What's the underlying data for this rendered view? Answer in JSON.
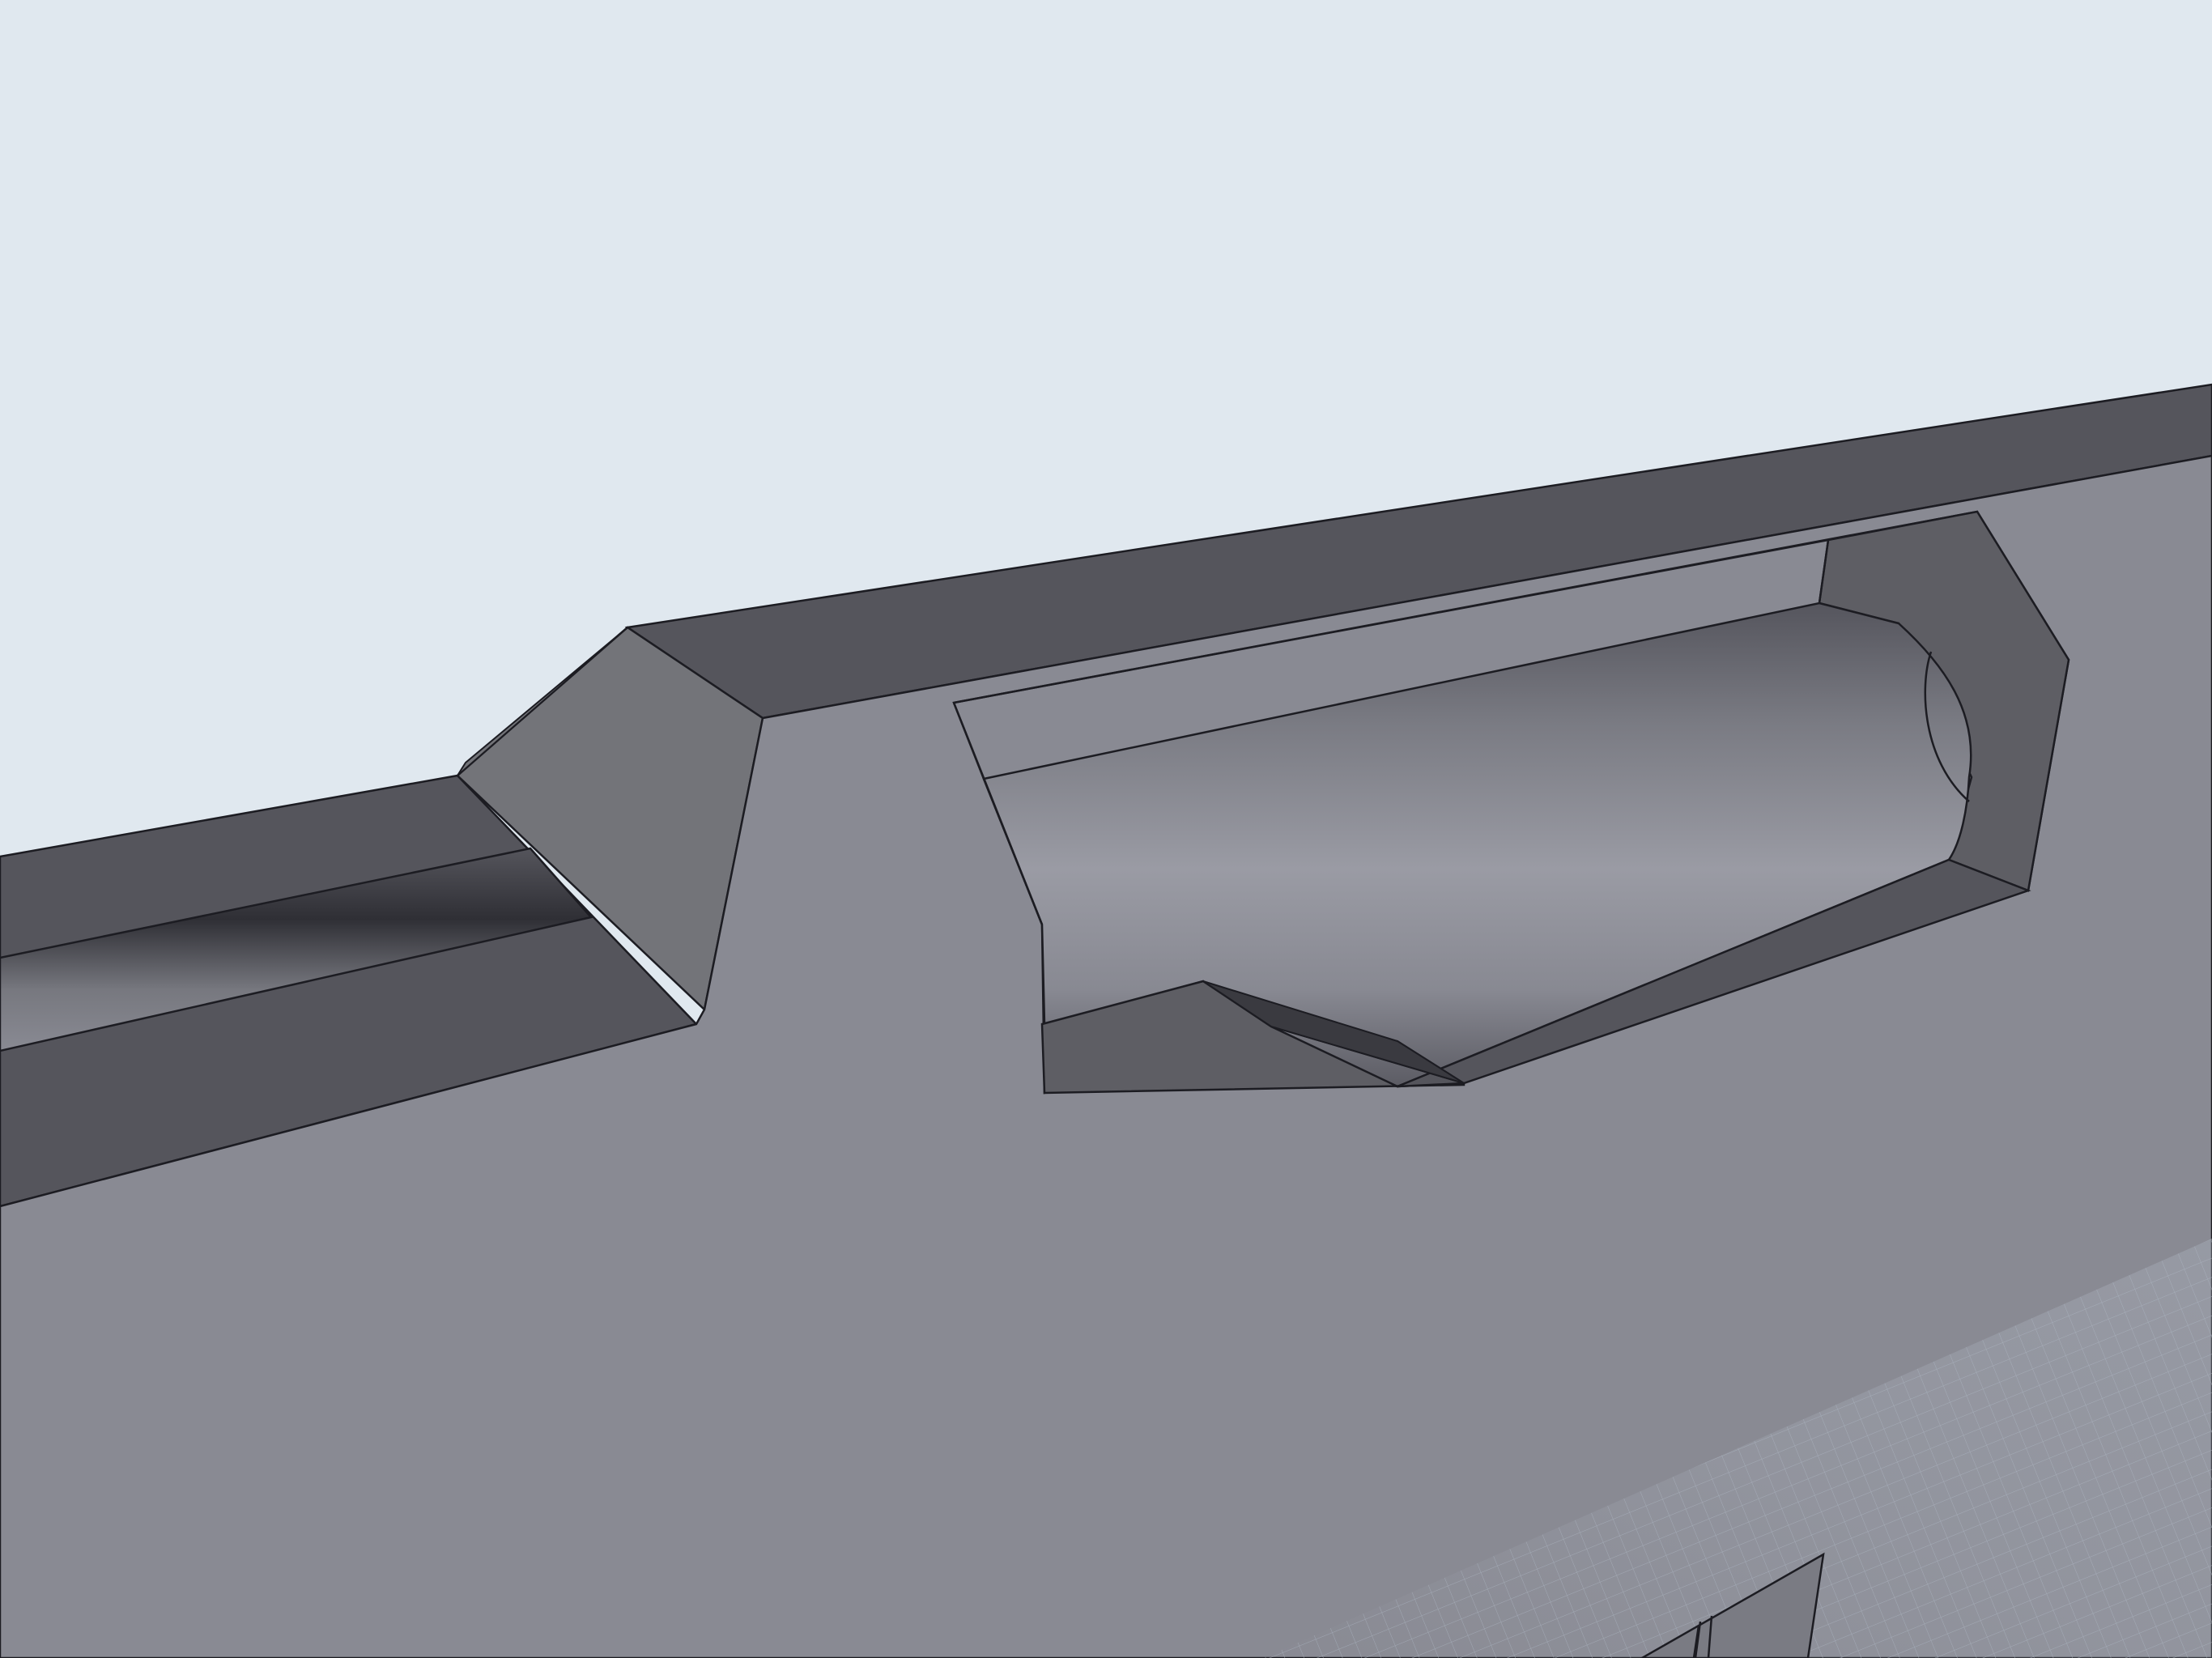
{
  "viewport": {
    "view_type": "3D CAD model viewport",
    "background_color": "#e0e8ef",
    "grid_color": "#b4bcc8"
  },
  "model": {
    "faces": {
      "front_face": "#898a93",
      "top_face": "#55555c",
      "bevel_light": "#737479",
      "bevel_dark": "#5e5e64",
      "edge_stroke": "#1c1c22",
      "bore_highlight": "#9a9ba4",
      "bore_shadow": "#606068",
      "notch_shadow": "#2e2e34"
    }
  }
}
